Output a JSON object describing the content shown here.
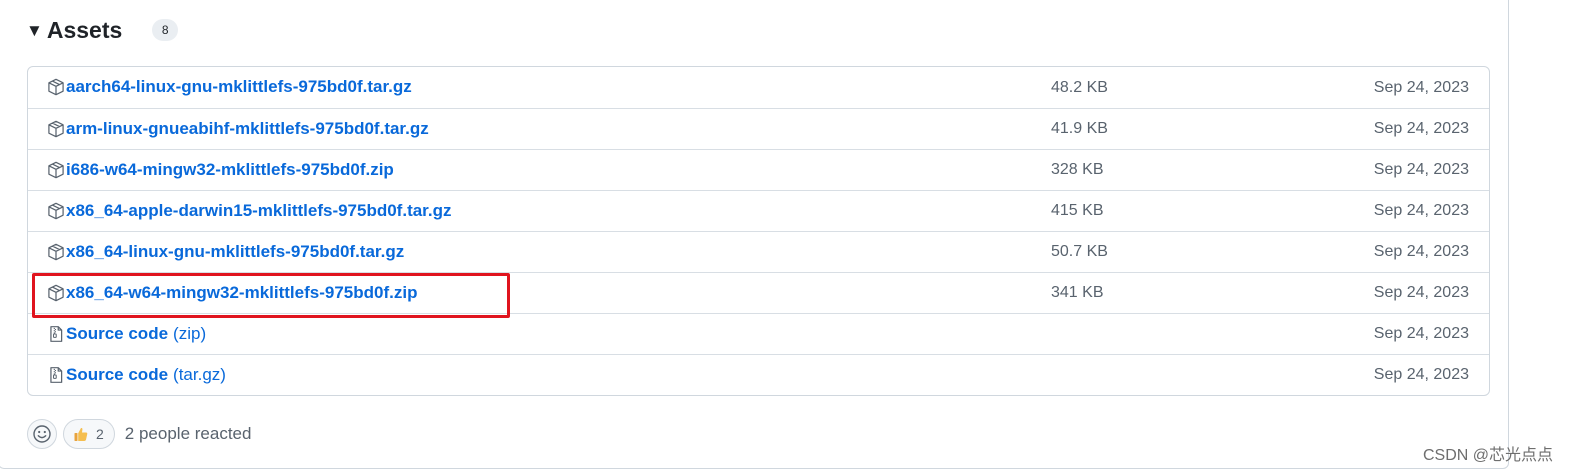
{
  "assets": {
    "title": "Assets",
    "count": "8",
    "items": [
      {
        "name": "aarch64-linux-gnu-mklittlefs-975bd0f.tar.gz",
        "size": "48.2 KB",
        "date": "Sep 24, 2023"
      },
      {
        "name": "arm-linux-gnueabihf-mklittlefs-975bd0f.tar.gz",
        "size": "41.9 KB",
        "date": "Sep 24, 2023"
      },
      {
        "name": "i686-w64-mingw32-mklittlefs-975bd0f.zip",
        "size": "328 KB",
        "date": "Sep 24, 2023"
      },
      {
        "name": "x86_64-apple-darwin15-mklittlefs-975bd0f.tar.gz",
        "size": "415 KB",
        "date": "Sep 24, 2023"
      },
      {
        "name": "x86_64-linux-gnu-mklittlefs-975bd0f.tar.gz",
        "size": "50.7 KB",
        "date": "Sep 24, 2023"
      },
      {
        "name": "x86_64-w64-mingw32-mklittlefs-975bd0f.zip",
        "size": "341 KB",
        "date": "Sep 24, 2023"
      }
    ],
    "source": [
      {
        "name": "Source code",
        "suffix": "(zip)",
        "date": "Sep 24, 2023"
      },
      {
        "name": "Source code",
        "suffix": "(tar.gz)",
        "date": "Sep 24, 2023"
      }
    ]
  },
  "reactions": {
    "thumbs_count": "2",
    "summary": "2 people reacted"
  },
  "watermark": "CSDN @芯光点点",
  "colors": {
    "link": "#0969da",
    "highlight": "#e0141e",
    "muted": "#59636e"
  }
}
